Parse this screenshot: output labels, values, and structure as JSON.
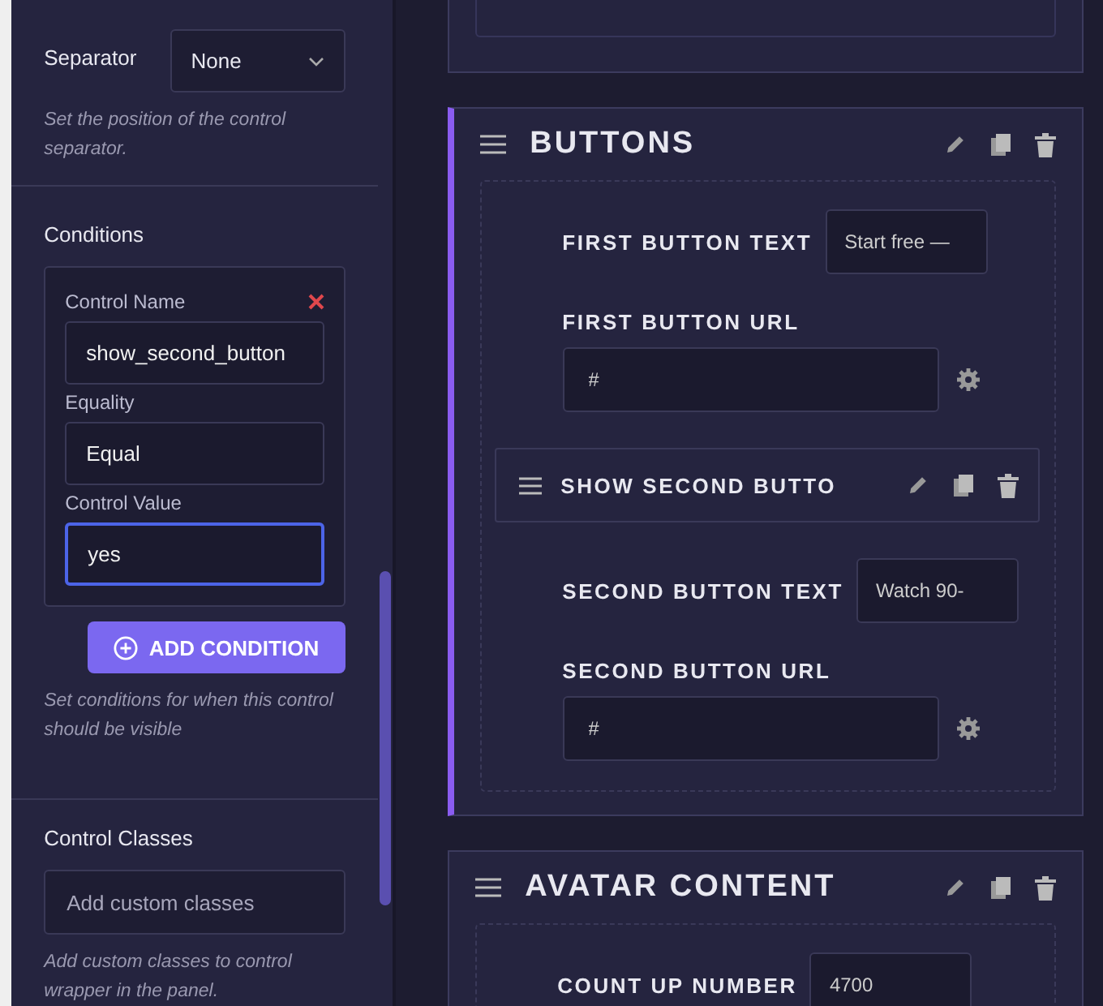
{
  "sidebar": {
    "separator": {
      "label": "Separator",
      "value": "None",
      "help": "Set the position of the control separator."
    },
    "conditions": {
      "label": "Conditions",
      "fields": [
        {
          "label": "Control Name",
          "value": "show_second_button",
          "focused": false,
          "removable": true
        },
        {
          "label": "Equality",
          "value": "Equal",
          "focused": false,
          "removable": false
        },
        {
          "label": "Control Value",
          "value": "yes",
          "focused": true,
          "removable": false
        }
      ],
      "add_button": "ADD CONDITION",
      "help": "Set conditions for when this control should be visible"
    },
    "control_classes": {
      "label": "Control Classes",
      "placeholder": "Add custom classes",
      "help": "Add custom classes to control wrapper in the panel."
    }
  },
  "blocks": [
    {
      "title": "BUTTONS",
      "selected": true,
      "fields": [
        {
          "kind": "inline",
          "label": "FIRST BUTTON TEXT",
          "value": "Start free —"
        },
        {
          "kind": "url",
          "label": "FIRST BUTTON URL",
          "value": "#"
        },
        {
          "kind": "group",
          "label": "SHOW SECOND BUTTO"
        },
        {
          "kind": "inline",
          "label": "SECOND BUTTON TEXT",
          "value": "Watch 90-"
        },
        {
          "kind": "url",
          "label": "SECOND BUTTON URL",
          "value": "#"
        }
      ]
    },
    {
      "title": "AVATAR CONTENT",
      "selected": false,
      "fields": [
        {
          "kind": "inline",
          "label": "COUNT UP NUMBER",
          "value": "4700"
        }
      ]
    }
  ]
}
